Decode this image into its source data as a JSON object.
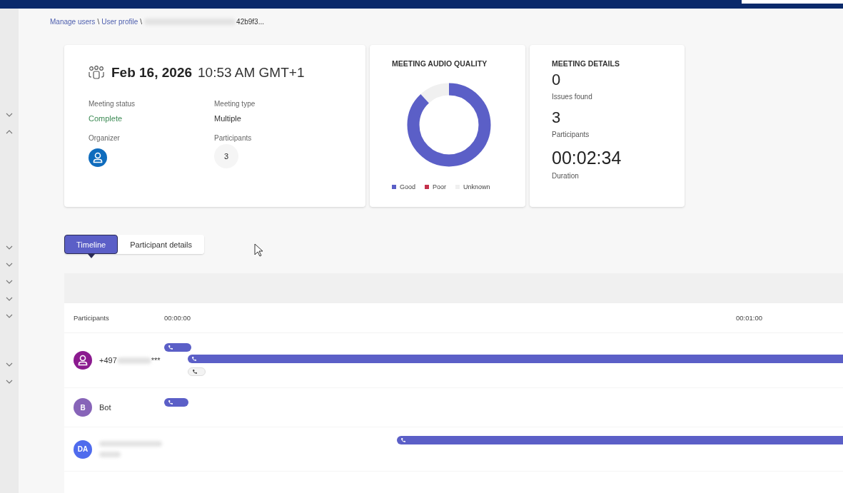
{
  "breadcrumb": {
    "links": [
      "Manage users",
      "User profile"
    ],
    "separator": "\\",
    "current": "42b9f3..."
  },
  "nav_chevrons": [
    {
      "expanded": false
    },
    {
      "expanded": true
    },
    {
      "expanded": false
    },
    {
      "expanded": false
    },
    {
      "expanded": false
    },
    {
      "expanded": false
    },
    {
      "expanded": false
    },
    {
      "expanded": false
    },
    {
      "expanded": false
    }
  ],
  "summary": {
    "date": "Feb 16, 2026",
    "time": "10:53 AM GMT+1",
    "fields": [
      {
        "label": "Meeting status",
        "value": "Complete",
        "kind": "status"
      },
      {
        "label": "Meeting type",
        "value": "Multiple",
        "kind": "text"
      },
      {
        "label": "Organizer",
        "kind": "avatar"
      },
      {
        "label": "Participants",
        "value": "3",
        "kind": "count"
      }
    ]
  },
  "audio_quality": {
    "title": "MEETING AUDIO QUALITY",
    "legend": [
      {
        "label": "Good",
        "color": "#5b5fc7"
      },
      {
        "label": "Poor",
        "color": "#c4314b"
      },
      {
        "label": "Unknown",
        "color": "#f0f0f0"
      }
    ]
  },
  "meeting_details": {
    "title": "MEETING DETAILS",
    "stats": [
      {
        "value": "0",
        "label": "Issues found",
        "kind": "small"
      },
      {
        "value": "3",
        "label": "Participants",
        "kind": "small"
      },
      {
        "value": "00:02:34",
        "label": "Duration",
        "kind": "large"
      }
    ]
  },
  "tabs": [
    {
      "label": "Timeline",
      "selected": true
    },
    {
      "label": "Participant details",
      "selected": false
    }
  ],
  "timeline": {
    "header": "Participants",
    "ticks": [
      "00:00:00",
      "00:01:00"
    ],
    "participants": [
      {
        "kind": "person",
        "color": "#8b1a8f",
        "name": "+497",
        "suffix": "***",
        "segments": [
          {
            "active": true
          },
          {
            "active": true
          },
          {
            "active": false
          }
        ]
      },
      {
        "kind": "initials",
        "initials": "B",
        "color": "#8764b8",
        "name": "Bot",
        "segments": [
          {
            "active": true
          }
        ]
      },
      {
        "kind": "initials",
        "initials": "DA",
        "color": "#4f6bed",
        "segments": [
          {
            "active": true
          }
        ]
      }
    ]
  }
}
